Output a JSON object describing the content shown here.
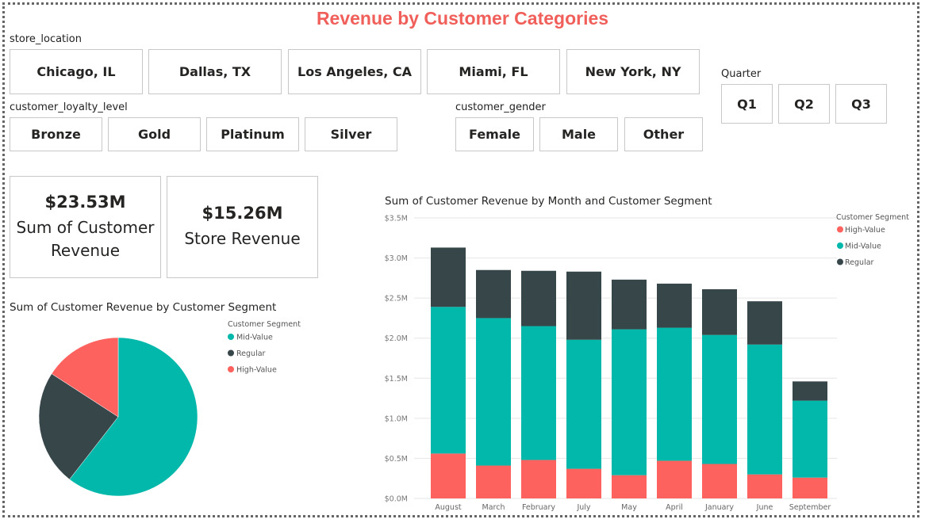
{
  "title": "Revenue by Customer Categories",
  "slicers": {
    "store_location": {
      "label": "store_location",
      "options": [
        "Chicago, IL",
        "Dallas, TX",
        "Los Angeles, CA",
        "Miami, FL",
        "New York, NY"
      ]
    },
    "quarter": {
      "label": "Quarter",
      "options": [
        "Q1",
        "Q2",
        "Q3"
      ]
    },
    "loyalty": {
      "label": "customer_loyalty_level",
      "options": [
        "Bronze",
        "Gold",
        "Platinum",
        "Silver"
      ]
    },
    "gender": {
      "label": "customer_gender",
      "options": [
        "Female",
        "Male",
        "Other"
      ]
    }
  },
  "cards": [
    {
      "value": "$23.53M",
      "label_line1": "Sum of Customer",
      "label_line2": "Revenue"
    },
    {
      "value": "$15.26M",
      "label_line1": "Store Revenue",
      "label_line2": ""
    }
  ],
  "colors": {
    "high_value": "#fd625e",
    "mid_value": "#01b8aa",
    "regular": "#374649",
    "title": "#f05f5a"
  },
  "chart_data": [
    {
      "type": "pie",
      "title": "Sum of Customer Revenue by Customer Segment",
      "legend_title": "Customer Segment",
      "legend_position": "top-right",
      "slices": [
        {
          "name": "Mid-Value",
          "value": 14.24,
          "color": "#01b8aa"
        },
        {
          "name": "Regular",
          "value": 5.56,
          "color": "#374649"
        },
        {
          "name": "High-Value",
          "value": 3.73,
          "color": "#fd625e"
        }
      ]
    },
    {
      "type": "bar",
      "stacked": true,
      "title": "Sum of Customer Revenue by Month and Customer Segment",
      "legend_title": "Customer Segment",
      "legend_position": "top-right",
      "categories": [
        "August",
        "March",
        "February",
        "July",
        "May",
        "April",
        "January",
        "June",
        "September"
      ],
      "ylim": [
        0,
        3.5
      ],
      "yticks": [
        "$0.0M",
        "$0.5M",
        "$1.0M",
        "$1.5M",
        "$2.0M",
        "$2.5M",
        "$3.0M",
        "$3.5M"
      ],
      "series": [
        {
          "name": "High-Value",
          "color": "#fd625e",
          "values": [
            0.56,
            0.41,
            0.48,
            0.37,
            0.29,
            0.47,
            0.43,
            0.3,
            0.26
          ]
        },
        {
          "name": "Mid-Value",
          "color": "#01b8aa",
          "values": [
            1.83,
            1.84,
            1.67,
            1.61,
            1.82,
            1.66,
            1.61,
            1.62,
            0.96
          ]
        },
        {
          "name": "Regular",
          "color": "#374649",
          "values": [
            0.74,
            0.6,
            0.69,
            0.85,
            0.62,
            0.55,
            0.57,
            0.54,
            0.24
          ]
        }
      ],
      "grid": true
    }
  ]
}
